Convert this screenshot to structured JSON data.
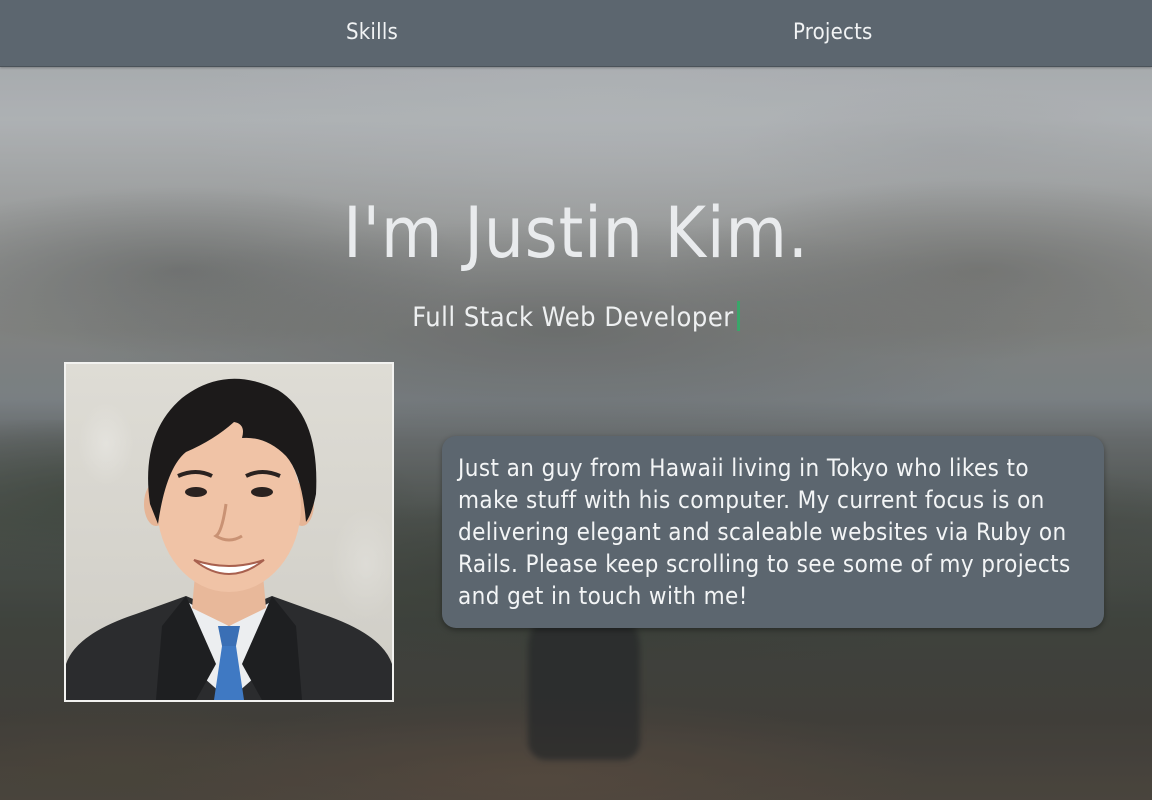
{
  "nav": {
    "items": [
      {
        "label": "Skills"
      },
      {
        "label": "Projects"
      }
    ]
  },
  "hero": {
    "title": "I'm Justin Kim.",
    "subtitle": "Full Stack Web Developer"
  },
  "bio": {
    "text": "Just an guy from Hawaii living in Tokyo who likes to make stuff with his computer. My current focus is on delivering elegant and scaleable websites via Ruby on Rails. Please keep scrolling to see some of my projects and get in touch with me!"
  },
  "colors": {
    "navbar": "#5c666f",
    "card": "#5c666f",
    "cursor": "#3aa66a",
    "text": "#f1f3f4"
  },
  "icons": {
    "typing_cursor": "text-cursor-icon"
  }
}
